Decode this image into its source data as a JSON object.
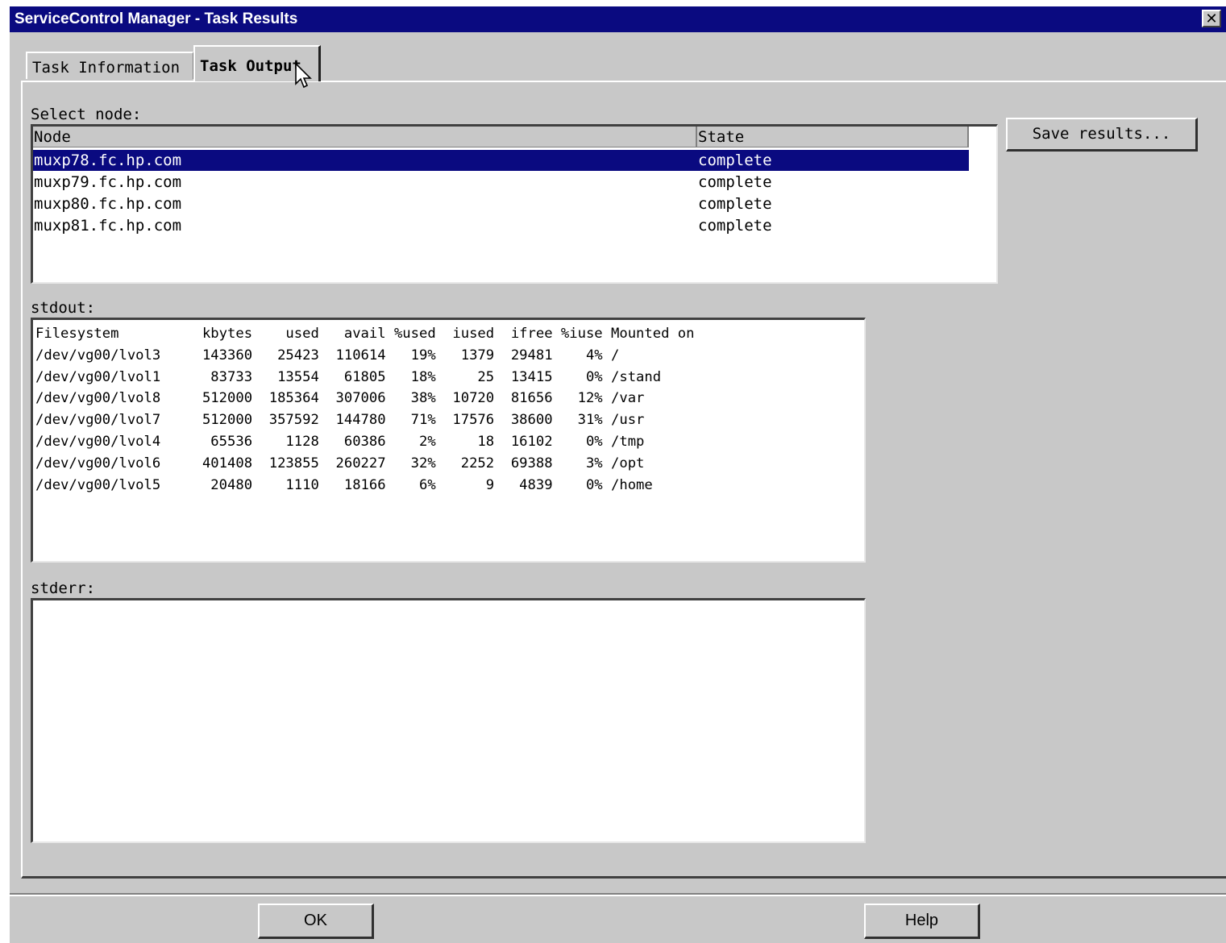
{
  "window": {
    "title": "ServiceControl Manager - Task Results",
    "close_glyph": "✕"
  },
  "tabs": [
    {
      "label": "Task Information",
      "active": false
    },
    {
      "label": "Task Output",
      "active": true
    }
  ],
  "node_panel": {
    "label": "Select node:",
    "columns": [
      "Node",
      "State"
    ],
    "rows": [
      {
        "node": "muxp78.fc.hp.com",
        "state": "complete",
        "selected": true
      },
      {
        "node": "muxp79.fc.hp.com",
        "state": "complete",
        "selected": false
      },
      {
        "node": "muxp80.fc.hp.com",
        "state": "complete",
        "selected": false
      },
      {
        "node": "muxp81.fc.hp.com",
        "state": "complete",
        "selected": false
      }
    ]
  },
  "save_button": {
    "label": "Save results..."
  },
  "stdout": {
    "label": "stdout:",
    "lines": [
      "Filesystem          kbytes    used   avail %used  iused  ifree %iuse Mounted on",
      "/dev/vg00/lvol3     143360   25423  110614   19%   1379  29481    4% /",
      "/dev/vg00/lvol1      83733   13554   61805   18%     25  13415    0% /stand",
      "/dev/vg00/lvol8     512000  185364  307006   38%  10720  81656   12% /var",
      "/dev/vg00/lvol7     512000  357592  144780   71%  17576  38600   31% /usr",
      "/dev/vg00/lvol4      65536    1128   60386    2%     18  16102    0% /tmp",
      "/dev/vg00/lvol6     401408  123855  260227   32%   2252  69388    3% /opt",
      "/dev/vg00/lvol5      20480    1110   18166    6%      9   4839    0% /home"
    ]
  },
  "stderr": {
    "label": "stderr:",
    "text": ""
  },
  "footer": {
    "ok_label": "OK",
    "help_label": "Help"
  },
  "colors": {
    "titlebar": "#0a0a80",
    "selection": "#0a0a80",
    "window_bg": "#c8c8c8"
  }
}
